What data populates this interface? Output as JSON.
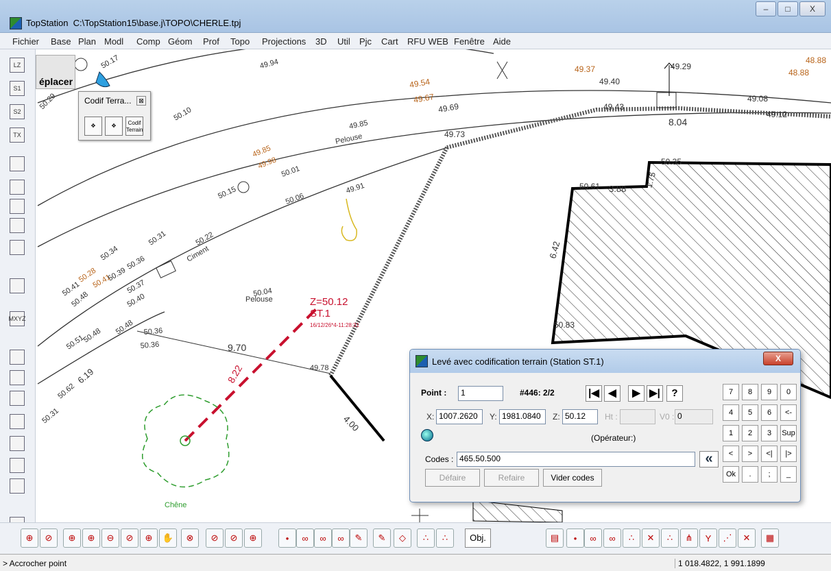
{
  "window": {
    "app_name": "TopStation",
    "file_path": "C:\\TopStation15\\base.j\\TOPO\\CHERLE.tpj",
    "close_glyph": "X"
  },
  "menu": [
    "Fichier",
    "Base",
    "Plan",
    "Modl",
    "Comp",
    "Géom",
    "Prof",
    "Topo",
    "Projections",
    "3D",
    "Util",
    "Pjc",
    "Cart",
    "RFU WEB",
    "Fenêtre",
    "Aide"
  ],
  "left_toolbar": [
    {
      "icon": "layer-z-icon",
      "label": "LZ"
    },
    {
      "icon": "layer-s1-icon",
      "label": "S1"
    },
    {
      "icon": "layer-s2-icon",
      "label": "S2"
    },
    {
      "icon": "layer-tx-icon",
      "label": "TX"
    },
    {
      "icon": "point-grid-icon",
      "label": ""
    },
    {
      "icon": "circle-tool-icon",
      "label": ""
    },
    {
      "icon": "point-move-icon",
      "label": ""
    },
    {
      "icon": "point-edit-icon",
      "label": ""
    },
    {
      "icon": "delete-x-icon",
      "label": ""
    },
    {
      "icon": "layers-stack-icon",
      "label": ""
    },
    {
      "icon": "import-mxyz-icon",
      "label": "MXYZ"
    },
    {
      "icon": "notebook-icon",
      "label": ""
    },
    {
      "icon": "undo-icon",
      "label": ""
    },
    {
      "icon": "redo-icon",
      "label": ""
    },
    {
      "icon": "codif-tool-icon",
      "label": ""
    },
    {
      "icon": "printer-icon",
      "label": ""
    },
    {
      "icon": "tools-icon",
      "label": ""
    },
    {
      "icon": "layer-menu-icon",
      "label": ""
    },
    {
      "icon": "grid-table-icon",
      "label": ""
    }
  ],
  "canvas": {
    "mode_label": "éplacer",
    "labels": [
      {
        "t": "50.17"
      },
      {
        "t": "49.94"
      },
      {
        "t": "50.29"
      },
      {
        "t": "50.10"
      },
      {
        "t": "49.37"
      },
      {
        "t": "49.29"
      },
      {
        "t": "49.40"
      },
      {
        "t": "48.88"
      },
      {
        "t": "48.88"
      },
      {
        "t": "49.08"
      },
      {
        "t": "49.12"
      },
      {
        "t": "49.54"
      },
      {
        "t": "49.67"
      },
      {
        "t": "49.69"
      },
      {
        "t": "49.43"
      },
      {
        "t": "8.04"
      },
      {
        "t": "49.85"
      },
      {
        "t": "Pelouse"
      },
      {
        "t": "49.73"
      },
      {
        "t": "49.85"
      },
      {
        "t": "49.98"
      },
      {
        "t": "50.01"
      },
      {
        "t": "50.15"
      },
      {
        "t": "50.06"
      },
      {
        "t": "49.91"
      },
      {
        "t": "50.35"
      },
      {
        "t": "50.61"
      },
      {
        "t": "3.88"
      },
      {
        "t": "1.75"
      },
      {
        "t": "6.42"
      },
      {
        "t": "50.83"
      },
      {
        "t": "50.34"
      },
      {
        "t": "50.31"
      },
      {
        "t": "50.22"
      },
      {
        "t": "Ciment"
      },
      {
        "t": "50.28"
      },
      {
        "t": "50.41"
      },
      {
        "t": "50.36"
      },
      {
        "t": "50.41"
      },
      {
        "t": "50.39"
      },
      {
        "t": "50.48"
      },
      {
        "t": "50.37"
      },
      {
        "t": "50.40"
      },
      {
        "t": "Pelouse"
      },
      {
        "t": "50.04"
      },
      {
        "t": "50.51"
      },
      {
        "t": "50.48"
      },
      {
        "t": "50.48"
      },
      {
        "t": "50.36"
      },
      {
        "t": "50.36"
      },
      {
        "t": "9.70"
      },
      {
        "t": "49.78"
      },
      {
        "t": "50.62"
      },
      {
        "t": "6.19"
      },
      {
        "t": "50.31"
      },
      {
        "t": "8.22"
      },
      {
        "t": "4.00"
      },
      {
        "t": "Chêne"
      }
    ],
    "station": {
      "z": "Z=50.12",
      "name": "ST.1",
      "stamp": "16/12/26*4-11:28:31"
    }
  },
  "codif_panel": {
    "title": "Codif Terra...",
    "buttons": [
      {
        "icon": "codif-point-icon",
        "label": ""
      },
      {
        "icon": "codif-line-icon",
        "label": ""
      },
      {
        "icon": "codif-terrain-icon",
        "label": "Codif Terrain"
      }
    ]
  },
  "dialog": {
    "title": "Levé avec codification terrain (Station ST.1)",
    "point_label": "Point :",
    "point_value": "1",
    "counter": "#446: 2/2",
    "x_label": "X:",
    "x_value": "1007.2620",
    "y_label": "Y:",
    "y_value": "1981.0840",
    "z_label": "Z:",
    "z_value": "50.12",
    "ht_label": "Ht :",
    "ht_value": "",
    "v0_label": "V0 :",
    "v0_value": "0",
    "operator": "(Opérateur:)",
    "codes_label": "Codes :",
    "codes_value": "465.50.500",
    "nav": [
      "|◀",
      "◀",
      "▶",
      "▶|",
      "?"
    ],
    "back_glyph": "«",
    "keypad": [
      "7",
      "8",
      "9",
      "0",
      "4",
      "5",
      "6",
      "<-",
      "1",
      "2",
      "3",
      "Sup",
      "<",
      ">",
      "<|",
      "|>",
      "Ok",
      ".",
      ";",
      "_"
    ],
    "buttons": {
      "undo": "Défaire",
      "redo": "Refaire",
      "clear": "Vider codes"
    }
  },
  "bottom_toolbar": {
    "obj_label": "Obj."
  },
  "status": {
    "left": "> Accrocher point",
    "coords": "1 018.4822, 1 991.1899"
  },
  "colors": {
    "accent": "#c8102e",
    "elevation_orange": "#b8641a",
    "chene": "#2e9d2e"
  }
}
